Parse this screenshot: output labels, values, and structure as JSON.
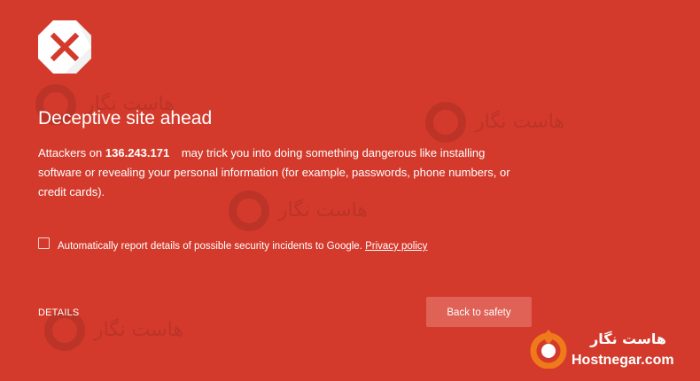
{
  "interstitial": {
    "heading": "Deceptive site ahead",
    "message_prefix": "Attackers on",
    "host": "136.243.171",
    "message_suffix": "may trick you into doing something dangerous like installing software or revealing your personal information (for example, passwords, phone numbers, or credit cards).",
    "report_label": "Automatically report details of possible security incidents to Google.",
    "privacy_link": "Privacy policy",
    "report_checked": false,
    "details_label": "DETAILS",
    "back_button_label": "Back to safety"
  },
  "watermark": {
    "brand_persian": "هاست نگار",
    "brand_latin": "Hostnegar.com"
  },
  "colors": {
    "background": "#d33a2c",
    "button": "#e06156",
    "brand_accent": "#f07a1a",
    "icon_red": "#d33a2c"
  },
  "icons": {
    "warning": "red-x-octagon-icon",
    "brand": "hostnegar-logo-icon"
  }
}
